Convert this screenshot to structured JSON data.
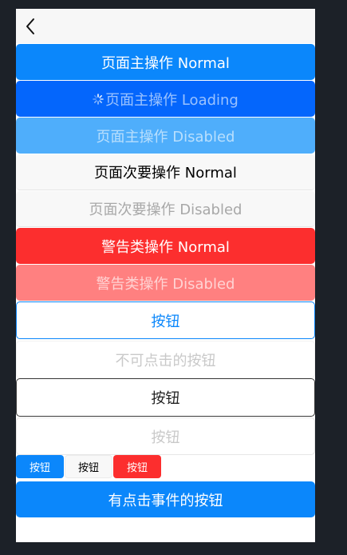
{
  "buttons": {
    "primary_normal": "页面主操作 Normal",
    "primary_loading": "页面主操作 Loading",
    "primary_disabled": "页面主操作 Disabled",
    "secondary_normal": "页面次要操作 Normal",
    "secondary_disabled": "页面次要操作 Disabled",
    "warn_normal": "警告类操作 Normal",
    "warn_disabled": "警告类操作 Disabled",
    "plain_primary": "按钮",
    "plain_primary_disabled": "不可点击的按钮",
    "plain_default": "按钮",
    "plain_default_disabled": "按钮",
    "mini_primary": "按钮",
    "mini_default": "按钮",
    "mini_warn": "按钮",
    "tap_event": "有点击事件的按钮"
  },
  "icons": {
    "back": "chevron-left-icon",
    "loading": "spinner-icon"
  },
  "colors": {
    "primary": "#0b87fb",
    "primary_loading": "#0466fc",
    "primary_disabled": "#4faefb",
    "warn": "#fc2e2e",
    "warn_disabled": "#ff8080",
    "default_bg": "#f8f8f8"
  }
}
